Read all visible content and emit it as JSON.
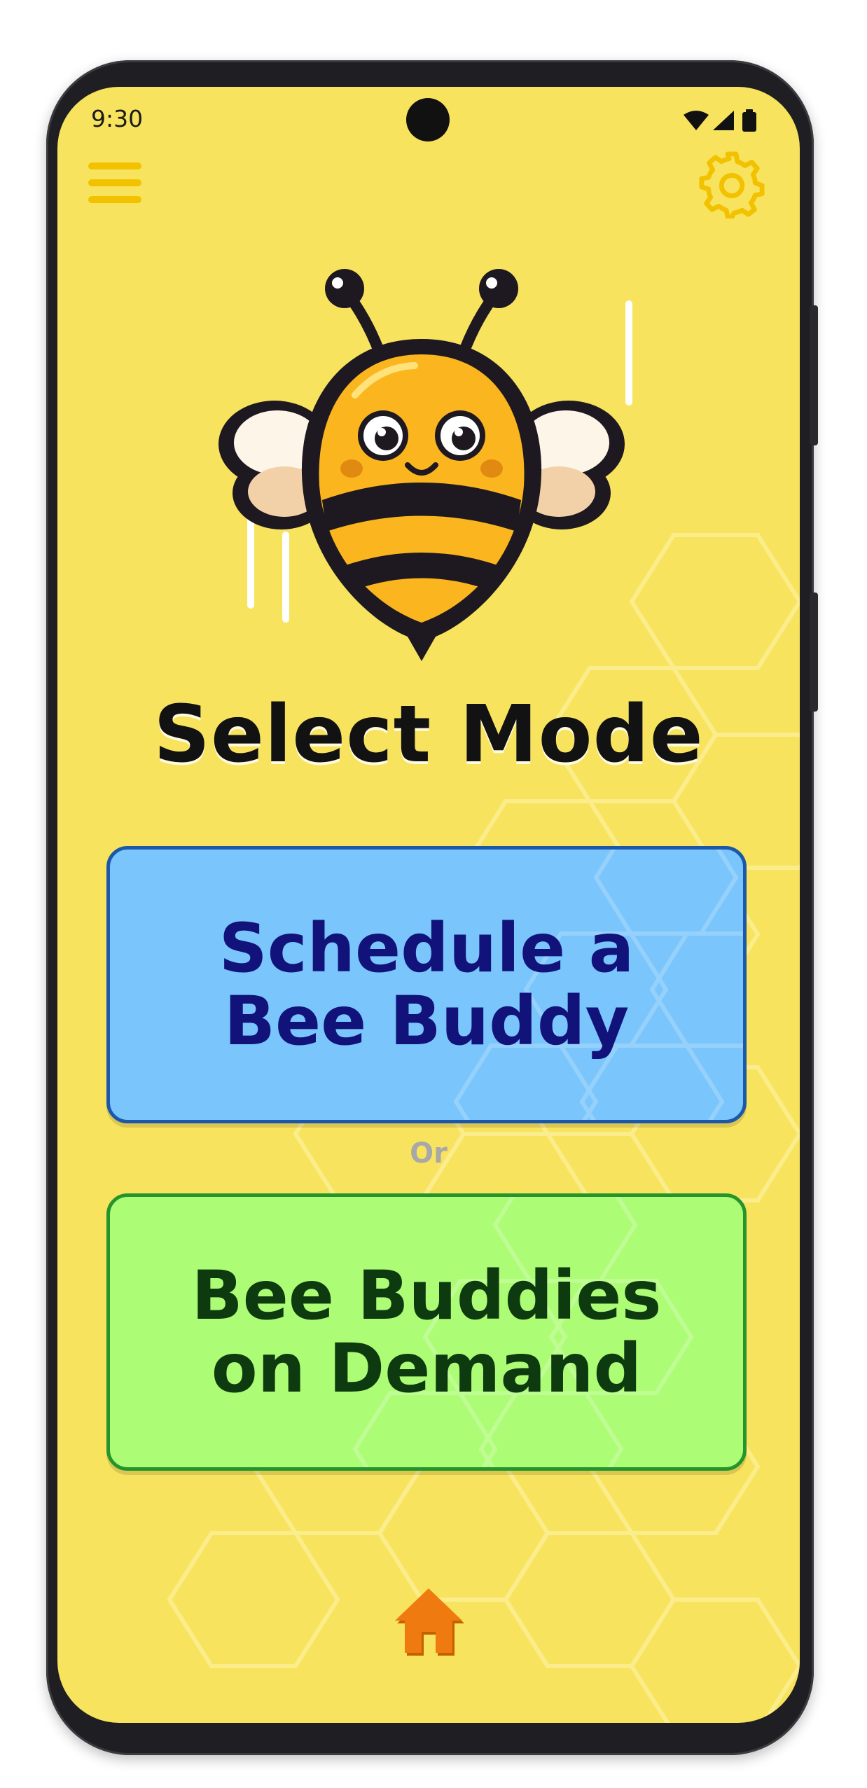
{
  "status_bar": {
    "time": "9:30"
  },
  "toolbar": {
    "menu_icon": "hamburger-menu-icon",
    "settings_icon": "gear-icon"
  },
  "mascot": {
    "icon": "bee-mascot"
  },
  "page": {
    "title": "Select Mode"
  },
  "modes": {
    "schedule": {
      "label": "Schedule a\nBee Buddy",
      "color": "#79c5fc",
      "text_color": "#12137a"
    },
    "separator": "Or",
    "on_demand": {
      "label": "Bee Buddies\non Demand",
      "color": "#adfc76",
      "text_color": "#0e3a10"
    }
  },
  "bottom_nav": {
    "home_icon": "home-icon"
  },
  "colors": {
    "background": "#f8e35e",
    "accent": "#f2c200",
    "home": "#ef7a10"
  }
}
